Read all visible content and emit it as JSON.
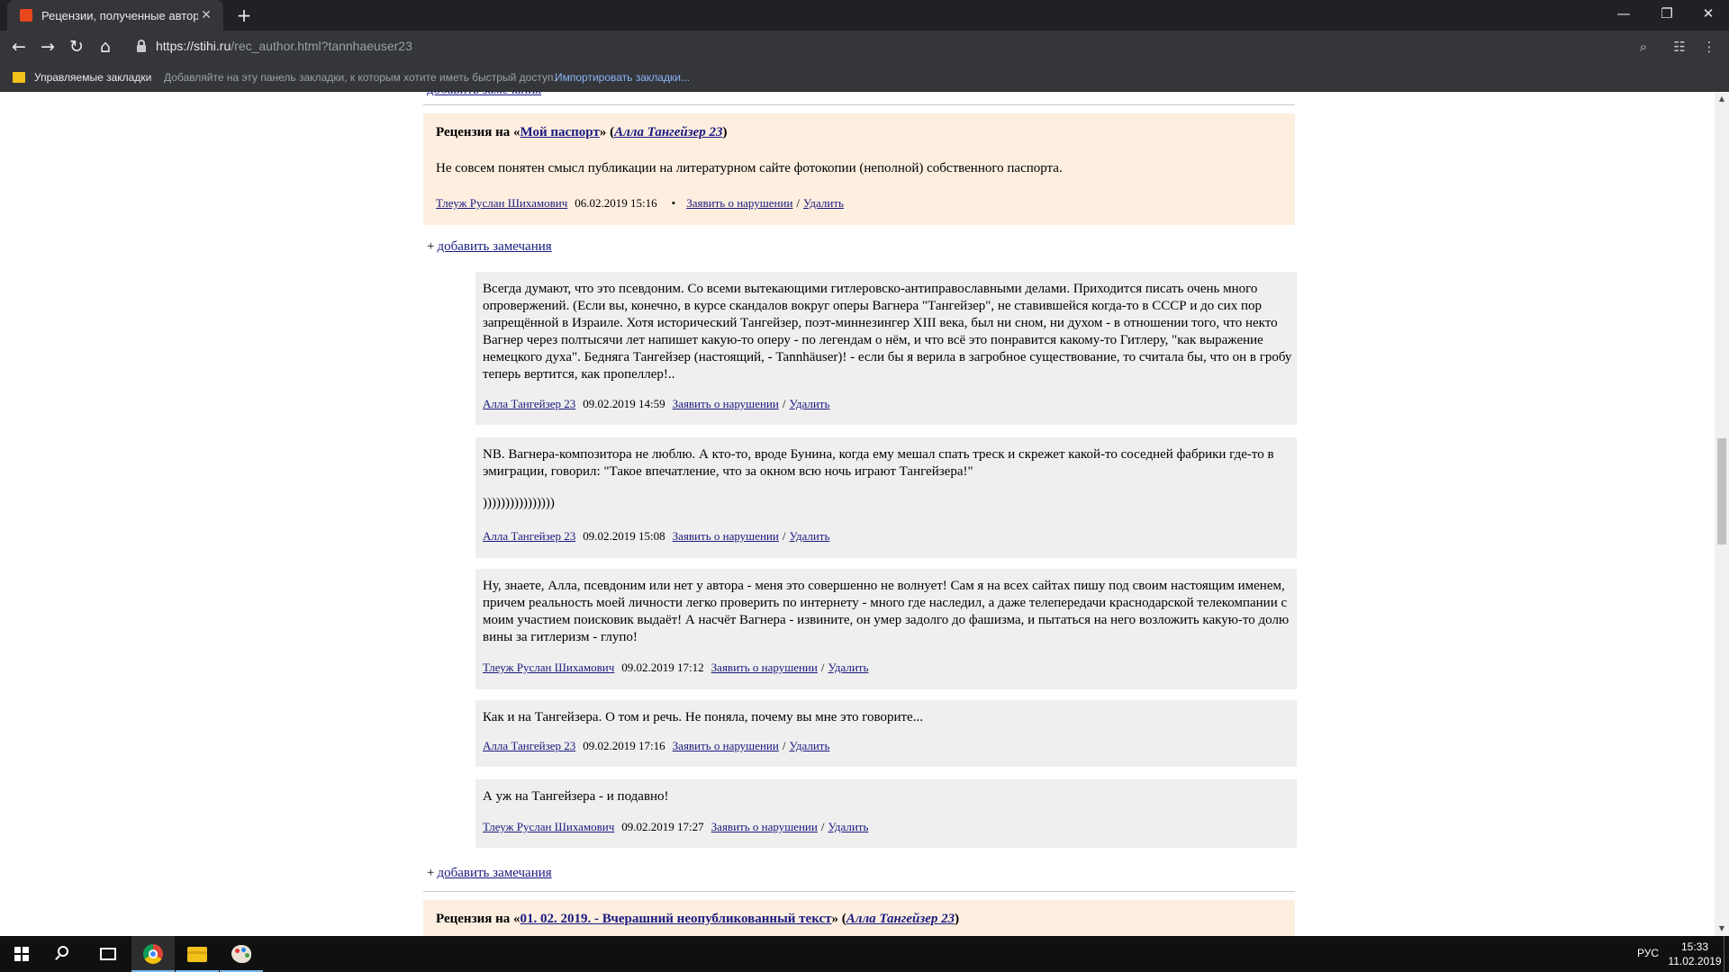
{
  "browser": {
    "tab_title": "Рецензии, полученные автором",
    "tab_close": "✕",
    "new_tab": "+",
    "url_host": "https://stihi.ru",
    "url_path": "/rec_author.html?tannhaeuser23",
    "bookmarks": {
      "managed": "Управляемые закладки",
      "hint": "Добавляйте на эту панель закладки, к которым хотите иметь быстрый доступ.",
      "import": "Импортировать закладки..."
    }
  },
  "page": {
    "add_notes": "добавить замечания",
    "add_notes_plus": "+",
    "review_prefix": "Рецензия на «",
    "review_mid": "» (",
    "review_suffix": ")",
    "report": "Заявить о нарушении",
    "delete": "Удалить",
    "slash": "/",
    "dot": "•",
    "reviews": [
      {
        "title": "Мой паспорт",
        "author": "Алла Тангейзер 23",
        "text": "Не совсем понятен смысл публикации на литературном сайте фотокопии (неполной) собственного паспорта.",
        "reviewer": "Тлеуж Руслан Шихамович",
        "date": "06.02.2019 15:16"
      },
      {
        "title": "01. 02. 2019. - Вчерашний неопубликованный текст",
        "author": "Алла Тангейзер 23"
      }
    ],
    "replies": [
      {
        "text": "Всегда думают, что это псевдоним. Со всеми вытекающими гитлеровско-антиправославными делами. Приходится писать очень много опровержений. (Если вы, конечно, в курсе скандалов вокруг оперы Вагнера \"Тангейзер\", не ставившейся когда-то в СССР и до сих пор запрещённой в Израиле. Хотя исторический Тангейзер, поэт-миннезингер XIII века, был ни сном, ни духом - в отношении того, что некто Вагнер через полтысячи лет напишет какую-то оперу - по легендам о нём, и что всё это понравится какому-то Гитлеру, \"как выражение немецкого духа\". Бедняга Тангейзер (настоящий, - Tannhäuser)! - если бы я верила в загробное существование, то считала бы, что он в гробу теперь вертится, как пропеллер!..",
        "author": "Алла Тангейзер 23",
        "date": "09.02.2019 14:59"
      },
      {
        "text": "NB. Вагнера-композитора не люблю. А кто-то, вроде Бунина, когда ему мешал спать треск и скрежет какой-то соседней фабрики где-то в эмиграции, говорил: \"Такое впечатление, что за окном всю ночь играют Тангейзера!\"",
        "text2": "))))))))))))))))",
        "author": "Алла Тангейзер 23",
        "date": "09.02.2019 15:08"
      },
      {
        "text": "Ну, знаете, Алла, псевдоним или нет у автора - меня это совершенно не волнует! Сам я на всех сайтах пишу под своим настоящим именем, причем реальность моей личности легко проверить по интернету - много где наследил, а даже телепередачи краснодарской телекомпании с моим участием поисковик выдаёт! А насчёт Вагнера - извините, он умер задолго до фашизма, и пытаться на него возложить какую-то долю вины за гитлеризм - глупо!",
        "author": "Тлеуж Руслан Шихамович",
        "date": "09.02.2019 17:12"
      },
      {
        "text": "Как и на Тангейзера. О том и речь. Не поняла, почему вы мне это говорите...",
        "author": "Алла Тангейзер 23",
        "date": "09.02.2019 17:16"
      },
      {
        "text": "А уж на Тангейзера - и подавно!",
        "author": "Тлеуж Руслан Шихамович",
        "date": "09.02.2019 17:27"
      }
    ]
  },
  "taskbar": {
    "lang": "РУС",
    "time": "15:33",
    "date": "11.02.2019"
  }
}
